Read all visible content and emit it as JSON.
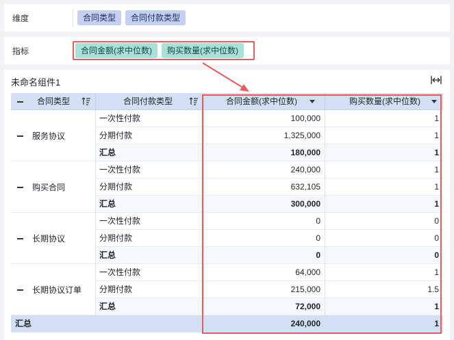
{
  "dimension": {
    "label": "维度",
    "chips": [
      "合同类型",
      "合同付款类型"
    ]
  },
  "indicator": {
    "label": "指标",
    "chips": [
      "合同金额(求中位数)",
      "购买数量(求中位数)"
    ]
  },
  "widget": {
    "title": "未命名组件1",
    "headers": {
      "col1": "合同类型",
      "col2": "合同付款类型",
      "col3": "合同金额(求中位数)",
      "col4": "购买数量(求中位数)"
    },
    "groups": [
      {
        "name": "服务协议",
        "rows": [
          {
            "type": "一次性付款",
            "amount": "100,000",
            "qty": "1"
          },
          {
            "type": "分期付款",
            "amount": "1,325,000",
            "qty": "1"
          },
          {
            "type": "汇总",
            "amount": "180,000",
            "qty": "1",
            "subtotal": true
          }
        ]
      },
      {
        "name": "购买合同",
        "rows": [
          {
            "type": "一次性付款",
            "amount": "240,000",
            "qty": "1"
          },
          {
            "type": "分期付款",
            "amount": "632,105",
            "qty": "1"
          },
          {
            "type": "汇总",
            "amount": "300,000",
            "qty": "1",
            "subtotal": true
          }
        ]
      },
      {
        "name": "长期协议",
        "rows": [
          {
            "type": "一次性付款",
            "amount": "0",
            "qty": "0"
          },
          {
            "type": "分期付款",
            "amount": "0",
            "qty": "0"
          },
          {
            "type": "汇总",
            "amount": "0",
            "qty": "0",
            "subtotal": true
          }
        ]
      },
      {
        "name": "长期协议订单",
        "rows": [
          {
            "type": "一次性付款",
            "amount": "64,000",
            "qty": "1"
          },
          {
            "type": "分期付款",
            "amount": "215,000",
            "qty": "1.5"
          },
          {
            "type": "汇总",
            "amount": "72,000",
            "qty": "1",
            "subtotal": true
          }
        ]
      }
    ],
    "total": {
      "label": "汇总",
      "amount": "240,000",
      "qty": "1"
    }
  },
  "colors": {
    "highlight": "#e85b56",
    "header_bg": "#d2dff4",
    "dim_chip": "#c5cff0",
    "ind_chip": "#a9e0d8"
  }
}
